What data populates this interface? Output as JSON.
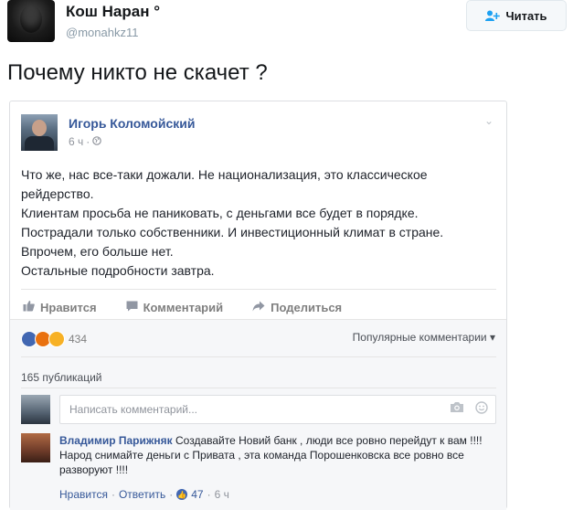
{
  "tweet": {
    "author_name": "Кош Наран °",
    "author_handle": "@monahkz11",
    "follow_label": "Читать",
    "text": "Почему никто не скачет ?"
  },
  "fb_post": {
    "author": "Игорь Коломойский",
    "time": "6 ч",
    "body_lines": [
      "Что же, нас все-таки дожали. Не национализация, это классическое",
      "рейдерство.",
      "Клиентам просьба не паниковать, с деньгами все будет в порядке.",
      "Пострадали только собственники. И инвестиционный климат в стране.",
      "Впрочем, его больше нет.",
      "Остальные подробности завтра."
    ],
    "actions": {
      "like": "Нравится",
      "comment": "Комментарий",
      "share": "Поделиться"
    },
    "reactions_count": "434",
    "sort_label": "Популярные комментарии",
    "publications": "165 публикаций",
    "comment_placeholder": "Написать комментарий...",
    "comment": {
      "author": "Владимир Парижняк",
      "text": "Создавайте Новий банк , люди все ровно перейдут к вам !!!! Народ снимайте деньги с Привата , эта команда Порошенковска все ровно все разворуют !!!!",
      "like_label": "Нравится",
      "reply_label": "Ответить",
      "likes": "47",
      "time": "6 ч"
    }
  },
  "colors": {
    "fb_link": "#365899",
    "twitter_blue": "#1da1f2"
  }
}
